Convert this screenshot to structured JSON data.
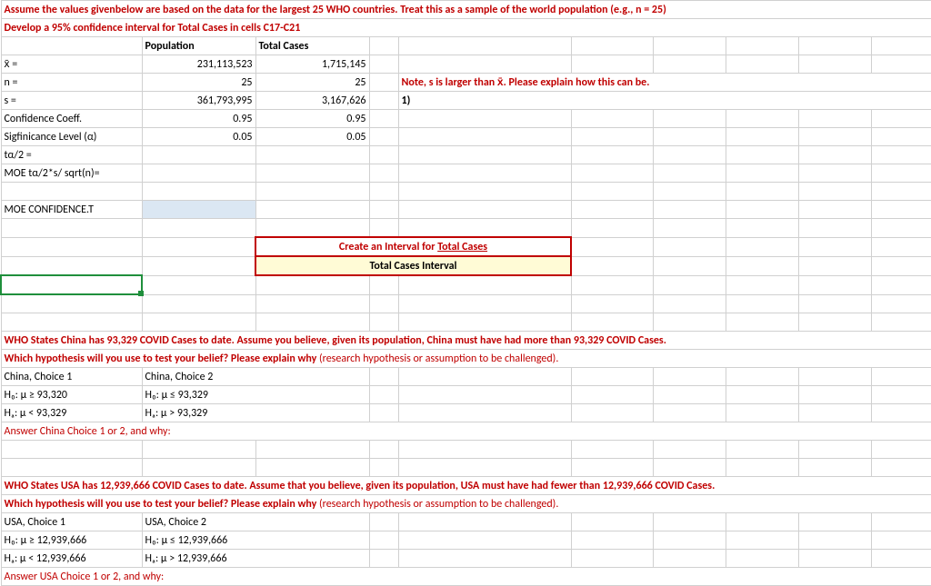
{
  "top": {
    "line1": "Assume the values givenbelow are based on the data for the largest 25 WHO countries. Treat this as a sample of the world population (e.g., n = 25)",
    "line2": "Develop a 95% confidence interval for Total Cases in cells C17-C21",
    "hdr_pop": "Population",
    "hdr_tc": "Total Cases",
    "rows": {
      "xbar": {
        "lab": "x̄ =",
        "pop": "231,113,523",
        "tc": "1,715,145"
      },
      "n": {
        "lab": "n =",
        "pop": "25",
        "tc": "25"
      },
      "s": {
        "lab": "s =",
        "pop": "361,793,995",
        "tc": "3,167,626"
      },
      "cc": {
        "lab": "Confidence Coeff.",
        "pop": "0.95",
        "tc": "0.95"
      },
      "sig": {
        "lab": "Sigfinicance Level (α)",
        "pop": "0.05",
        "tc": "0.05"
      },
      "ta2": {
        "lab": "tα/2 ="
      },
      "moe": {
        "lab": "MOE tα/2*s/ sqrt(n)="
      },
      "moect": {
        "lab": "MOE CONFIDENCE.T"
      }
    },
    "note_line": "Note, s is larger than x̄. Please explain how this can be.",
    "note_answer": "1)",
    "interval_title_pre": "Create an Interval for ",
    "interval_title_u": "Total Cases",
    "interval_sub": "Total Cases Interval"
  },
  "china": {
    "line1": "WHO States China has 93,329 COVID Cases to date. Assume you believe, given its population, China must have had more than 93,329 COVID Cases.",
    "line2a": "Which hypothesis will you use to test your belief? Please explain why",
    "line2b": " (research hypothesis or assumption to be challenged).",
    "c1": "China, Choice 1",
    "c2": "China, Choice 2",
    "h0_1": "H₀:  μ ≥ 93,320",
    "ha_1": "Hₐ:  μ < 93,329",
    "h0_2": "H₀:  μ ≤ 93,329",
    "ha_2": "Hₐ:  μ > 93,329",
    "ans": "Answer China Choice 1 or 2, and why:"
  },
  "usa": {
    "line1": "WHO States USA has 12,939,666 COVID Cases to date. Assume that you believe, given its population, USA must have had fewer than 12,939,666 COVID Cases.",
    "line2a": "Which hypothesis will you use to test your belief? Please explain why",
    "line2b": " (research hypothesis or assumption to be challenged).",
    "c1": " USA, Choice 1",
    "c2": "USA, Choice 2",
    "h0_1": "H₀:  μ ≥ 12,939,666",
    "ha_1": "Hₐ:  μ < 12,939,666",
    "h0_2": "H₀:  μ ≤ 12,939,666",
    "ha_2": "Hₐ:  μ > 12,939,666",
    "ans": "Answer USA Choice 1 or 2, and why:"
  }
}
